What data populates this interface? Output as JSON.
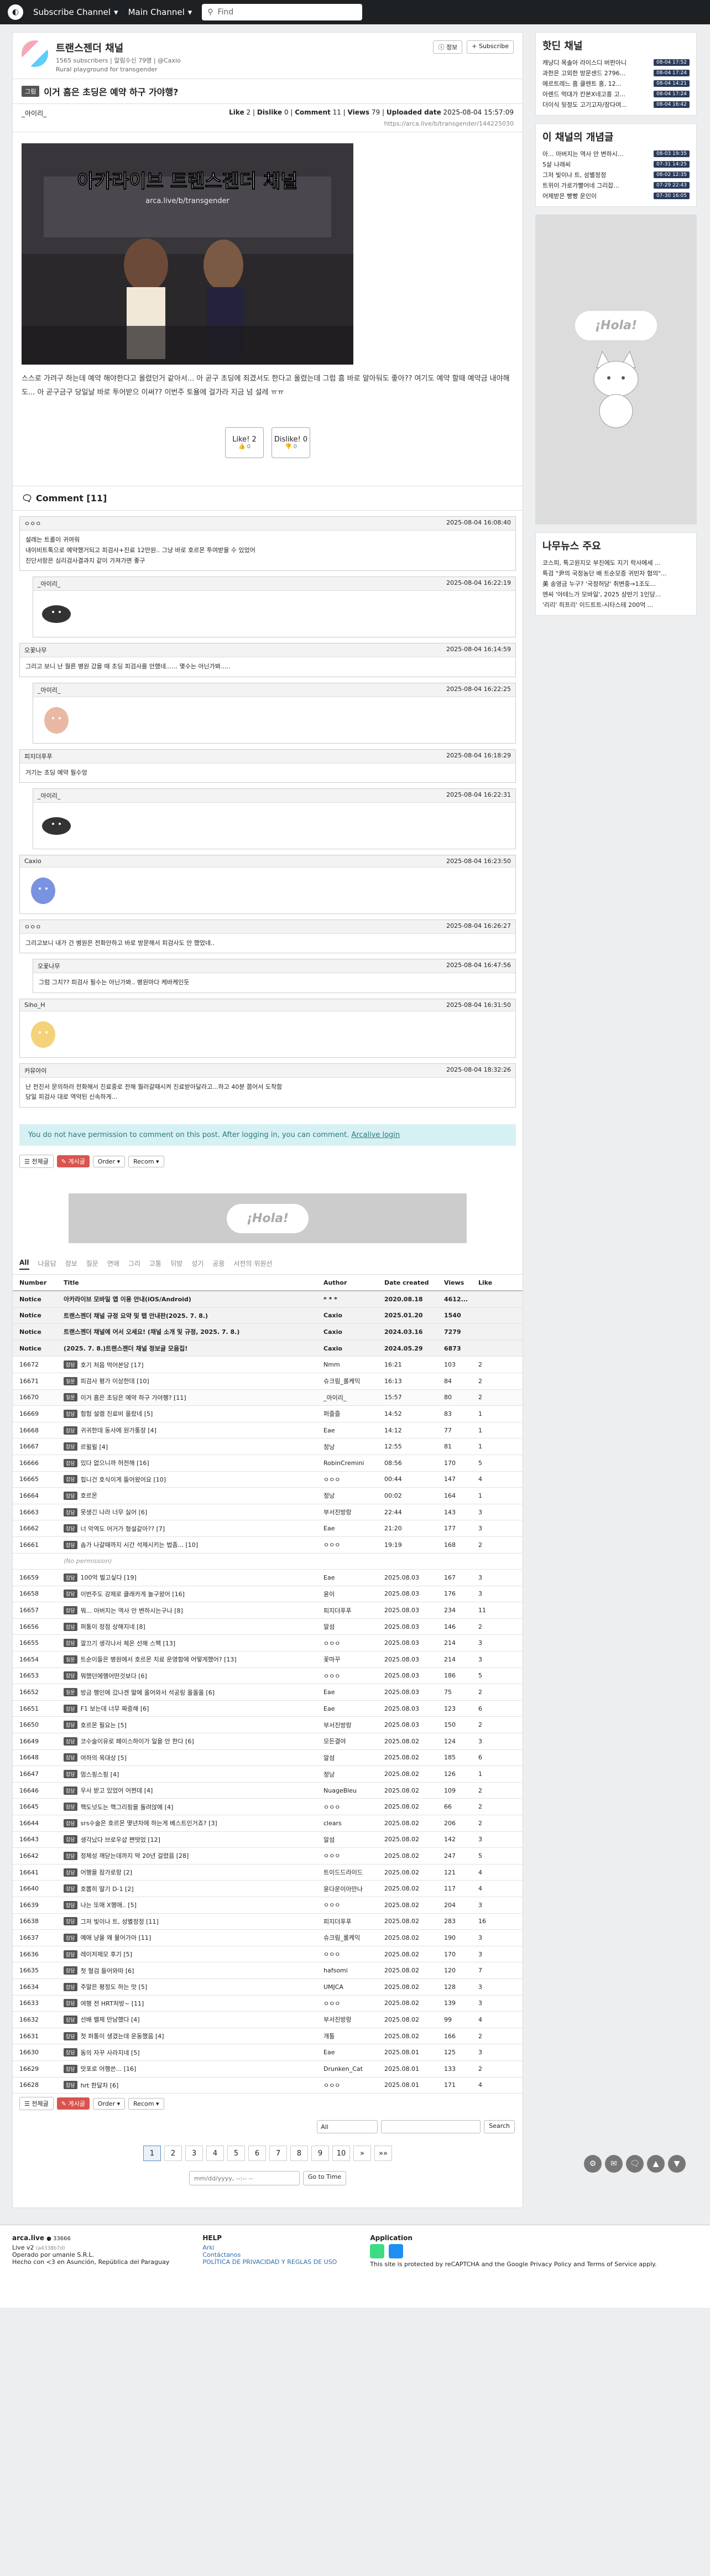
{
  "nav": {
    "brand": "Subscribe Channel",
    "main": "Main Channel",
    "search_placeholder": "Find"
  },
  "channel": {
    "name": "트랜스젠더 채널",
    "subscribers": "1565 subscribers | 알림수신 79명 | @Caxio",
    "desc": "Rural playground for transgender",
    "btn_channel": "정보",
    "btn_subscribe": "Subscribe"
  },
  "article": {
    "category": "그림",
    "title": "이거 흠은 초딩은 예약 하구 가야행?",
    "author": "_아이리_",
    "likes_label": "Like",
    "likes": "2",
    "dislikes_label": "Dislike",
    "dislikes": "0",
    "comments_label": "Comment",
    "comments": "11",
    "views_label": "Views",
    "views": "79",
    "date_label": "Uploaded date",
    "date": "2025-08-04 15:57:09",
    "url": "https://arca.live/b/transgender/144225030",
    "img_title": "아카라이브 트랜스젠더 채널",
    "img_sub": "arca.live/b/transgender",
    "body": "스스로 가려구 하는데 예약 해야한다고 올렸던거 같아서... 아 곧구 초딩에 죄겼서도 한다고 올렸는데 그럼 흠 바로 알아둬도 좋아?? 여기도 예약 할때 예약금 내야해도... 아 곧구금구 당일날 바로 투어받으 이써?? 이번주 토욜에 걸가라 지금 넘 설레 ㅠㅠ",
    "like_btn": "Like!",
    "like_count": "2",
    "like_sub": "0",
    "dislike_btn": "Dislike!",
    "dislike_count": "0",
    "dislike_sub": "0"
  },
  "comments": {
    "header": "Comment [11]",
    "list": [
      {
        "user": "ㅇㅇㅇ",
        "date": "2025-08-04 16:08:40",
        "text": "설레는 트롤이 귀여워\n내이비트톡으로 예약했거되고 피검사+진료 12만원.. 그냥 바로 호르몬 투여받을 수 있었어\n진단서랑은 심리검사결과지 같이 가져가면 좋구",
        "reply": false,
        "emote": ""
      },
      {
        "user": "_아이리_",
        "date": "2025-08-04 16:22:19",
        "text": "",
        "reply": true,
        "emote": "blob"
      },
      {
        "user": "오꽃나무",
        "date": "2025-08-04 16:14:59",
        "text": "그리고 보니 난 뭘른 병원 갔을 때 초딩 피검사를 안했네...... 몇수는 아닌가봐.....",
        "reply": false,
        "emote": ""
      },
      {
        "user": "_아이리_",
        "date": "2025-08-04 16:22:25",
        "text": "",
        "reply": true,
        "emote": "girl"
      },
      {
        "user": "피지더푸푸",
        "date": "2025-08-04 16:18:29",
        "text": "거기는 초딩 예약 필수엉",
        "reply": false,
        "emote": ""
      },
      {
        "user": "_아이리_",
        "date": "2025-08-04 16:22:31",
        "text": "",
        "reply": true,
        "emote": "blob"
      },
      {
        "user": "Caxio",
        "date": "2025-08-04 16:23:50",
        "text": "",
        "reply": false,
        "emote": "bunny"
      },
      {
        "user": "ㅇㅇㅇ",
        "date": "2025-08-04 16:26:27",
        "text": "그리고보니 내가 간 병원은 전화안하고 바로 방문해서 피검사도 안 했었네..",
        "reply": false,
        "emote": ""
      },
      {
        "user": "오꽃나무",
        "date": "2025-08-04 16:47:56",
        "text": "그럼 그치?? 피검사 필수는 아닌가봐.. 병원마다 케바케인듯",
        "reply": true,
        "emote": ""
      },
      {
        "user": "Siho_H",
        "date": "2025-08-04 16:31:50",
        "text": "",
        "reply": false,
        "emote": "blonde"
      },
      {
        "user": "커뮤아이",
        "date": "2025-08-04 18:32:26",
        "text": "난 전진서 문의하러 전화해서 진료중로 전해 뭘러갈때시켜 진료받아달라고...하고 40분 쯤어서 도착함\n당일 피검사 대로 역약된 신속하게...",
        "reply": false,
        "emote": ""
      }
    ]
  },
  "notice": {
    "text": "You do not have permission to comment on this post. After logging in, you can comment.",
    "link": "Arcalive login"
  },
  "controls": {
    "all": "전체글",
    "write": "게시글",
    "order": "Order",
    "recom": "Recom"
  },
  "banner": "¡Hola!",
  "tabs": [
    "All",
    "나음담",
    "정보",
    "질문",
    "연애",
    "그리",
    "고통",
    "뒤방",
    "성기",
    "공용",
    "서전의 위원선"
  ],
  "table": {
    "headers": [
      "Number",
      "Title",
      "Author",
      "Date created",
      "Views",
      "Like"
    ],
    "rows": [
      {
        "num": "Notice",
        "cat": "",
        "title": "아카라이브 모바일 앱 이용 안내(iOS/Android)",
        "author": "* * *",
        "date": "2020.08.18",
        "views": "4612...",
        "like": "",
        "kind": "notice"
      },
      {
        "num": "Notice",
        "cat": "",
        "title": "트랜스젠더 채널 규정 요약 및 탭 안내판(2025. 7. 8.)",
        "author": "Caxio",
        "date": "2025.01.20",
        "views": "1540",
        "like": "",
        "kind": "notice"
      },
      {
        "num": "Notice",
        "cat": "",
        "title": "트랜스젠더 채널에 어서 오세요! (채널 소개 및 규정, 2025. 7. 8.)",
        "author": "Caxio",
        "date": "2024.03.16",
        "views": "7279",
        "like": "",
        "kind": "notice"
      },
      {
        "num": "Notice",
        "cat": "",
        "title": "(2025. 7. 8.)트랜스젠더 채널 정보글 모음집!",
        "author": "Caxio",
        "date": "2024.05.29",
        "views": "6873",
        "like": "",
        "kind": "notice"
      },
      {
        "num": "16672",
        "cat": "잡담",
        "title": "호기 처음 먹어본당 [17]",
        "author": "Nmm",
        "date": "16:21",
        "views": "103",
        "like": "2",
        "kind": ""
      },
      {
        "num": "16671",
        "cat": "질문",
        "title": "피검사 평가 이상한데 [10]",
        "author": "슈크림_롤케익",
        "date": "16:13",
        "views": "84",
        "like": "2",
        "kind": ""
      },
      {
        "num": "16670",
        "cat": "질문",
        "title": "이거 흠은 초딩은 예약 하구 가야행? [11]",
        "author": "_아이리_",
        "date": "15:57",
        "views": "80",
        "like": "2",
        "kind": "current"
      },
      {
        "num": "16669",
        "cat": "잡담",
        "title": "험험 설렘 진료비 올랐네 [5]",
        "author": "퍼즐즐",
        "date": "14:52",
        "views": "83",
        "like": "1",
        "kind": ""
      },
      {
        "num": "16668",
        "cat": "잡담",
        "title": "귀귀한데 동사에 원가통장 [4]",
        "author": "Eae",
        "date": "14:12",
        "views": "77",
        "like": "1",
        "kind": ""
      },
      {
        "num": "16667",
        "cat": "잡담",
        "title": "르윌윌 [4]",
        "author": "정낭",
        "date": "12:55",
        "views": "81",
        "like": "1",
        "kind": ""
      },
      {
        "num": "16666",
        "cat": "잡담",
        "title": "있다 없으니까 허전해 [16]",
        "author": "RobinCremini",
        "date": "08:56",
        "views": "170",
        "like": "5",
        "kind": ""
      },
      {
        "num": "16665",
        "cat": "잡담",
        "title": "힙니건 호식이게 들어왔어요 [10]",
        "author": "ㅇㅇㅇ",
        "date": "00:44",
        "views": "147",
        "like": "4",
        "kind": ""
      },
      {
        "num": "16664",
        "cat": "잡담",
        "title": "호르몬",
        "author": "정낭",
        "date": "00:02",
        "views": "164",
        "like": "1",
        "kind": ""
      },
      {
        "num": "16663",
        "cat": "잡담",
        "title": "못생긴 나라 너무 싫어 [6]",
        "author": "부서진방랑",
        "date": "22:44",
        "views": "143",
        "like": "3",
        "kind": ""
      },
      {
        "num": "16662",
        "cat": "잡담",
        "title": "너 악역도 어거가 형설같아?? [7]",
        "author": "Eae",
        "date": "21:20",
        "views": "177",
        "like": "3",
        "kind": ""
      },
      {
        "num": "16661",
        "cat": "잡담",
        "title": "솜가 나갈때까지 시간 석제시키는 법좀... [10]",
        "author": "ㅇㅇㅇ",
        "date": "19:19",
        "views": "168",
        "like": "2",
        "kind": ""
      },
      {
        "num": "",
        "cat": "",
        "title": "(No permission)",
        "author": "",
        "date": "",
        "views": "",
        "like": "",
        "kind": "nopermission"
      },
      {
        "num": "16659",
        "cat": "잡담",
        "title": "100억 벌고싶다 [19]",
        "author": "Eae",
        "date": "2025.08.03",
        "views": "167",
        "like": "3",
        "kind": ""
      },
      {
        "num": "16658",
        "cat": "잡담",
        "title": "이번주도 강제로 클래카게 놀구왔어 [16]",
        "author": "윤이",
        "date": "2025.08.03",
        "views": "176",
        "like": "3",
        "kind": ""
      },
      {
        "num": "16657",
        "cat": "잡담",
        "title": "뭐... 아버지는 역사 안 변하시는구나 [8]",
        "author": "피지더푸푸",
        "date": "2025.08.03",
        "views": "234",
        "like": "11",
        "kind": ""
      },
      {
        "num": "16656",
        "cat": "잡담",
        "title": "퍼통이 정점 상해지네 [8]",
        "author": "알섬",
        "date": "2025.08.03",
        "views": "146",
        "like": "2",
        "kind": ""
      },
      {
        "num": "16655",
        "cat": "잡담",
        "title": "깔끄기 생각나서 체온 선해 스팩 [13]",
        "author": "ㅇㅇㅇ",
        "date": "2025.08.03",
        "views": "214",
        "like": "3",
        "kind": ""
      },
      {
        "num": "16654",
        "cat": "질문",
        "title": "트순이들은 병원에서 호르몬 치료 운영함에 어떻게했어? [13]",
        "author": "꽃마꾸",
        "date": "2025.08.03",
        "views": "214",
        "like": "3",
        "kind": ""
      },
      {
        "num": "16653",
        "cat": "잡담",
        "title": "뭐했던에행어떤것보다 [6]",
        "author": "ㅇㅇㅇ",
        "date": "2025.08.03",
        "views": "186",
        "like": "5",
        "kind": ""
      },
      {
        "num": "16652",
        "cat": "질문",
        "title": "방금 행인에 갔나겐 딸에 올어와서 석공링 올올올 [6]",
        "author": "Eae",
        "date": "2025.08.03",
        "views": "75",
        "like": "2",
        "kind": ""
      },
      {
        "num": "16651",
        "cat": "잡담",
        "title": "F1 보는데 너무 짜증해 [6]",
        "author": "Eae",
        "date": "2025.08.03",
        "views": "123",
        "like": "6",
        "kind": ""
      },
      {
        "num": "16650",
        "cat": "잡담",
        "title": "호르몬 필요는 [5]",
        "author": "부서진방랑",
        "date": "2025.08.03",
        "views": "150",
        "like": "2",
        "kind": ""
      },
      {
        "num": "16649",
        "cat": "잡담",
        "title": "코수술이유로 페이스하이가 일을 안 한다 [6]",
        "author": "모든결야",
        "date": "2025.08.02",
        "views": "124",
        "like": "3",
        "kind": ""
      },
      {
        "num": "16648",
        "cat": "잡담",
        "title": "여하의 목대상 [5]",
        "author": "알섬",
        "date": "2025.08.02",
        "views": "185",
        "like": "6",
        "kind": ""
      },
      {
        "num": "16647",
        "cat": "잡담",
        "title": "멈스핑스핑 [4]",
        "author": "정낭",
        "date": "2025.08.02",
        "views": "126",
        "like": "1",
        "kind": ""
      },
      {
        "num": "16646",
        "cat": "잡담",
        "title": "우사 받고 있었어 어쩐데 [4]",
        "author": "NuageBleu",
        "date": "2025.08.02",
        "views": "109",
        "like": "2",
        "kind": ""
      },
      {
        "num": "16645",
        "cat": "잡담",
        "title": "핵도넛도는 핵그리핑을 돌려앉에 [4]",
        "author": "ㅇㅇㅇ",
        "date": "2025.08.02",
        "views": "66",
        "like": "2",
        "kind": ""
      },
      {
        "num": "16644",
        "cat": "잡담",
        "title": "srs수술은 호르몬 몇년차에 하는게 베스트인거죠? [3]",
        "author": "clears",
        "date": "2025.08.02",
        "views": "206",
        "like": "2",
        "kind": ""
      },
      {
        "num": "16643",
        "cat": "잡담",
        "title": "생각났다 브로우샵 쪈떳었 [12]",
        "author": "알섬",
        "date": "2025.08.02",
        "views": "142",
        "like": "3",
        "kind": ""
      },
      {
        "num": "16642",
        "cat": "잡담",
        "title": "정체성 깨닫는데까지 딱 20년 걸렸음 [28]",
        "author": "ㅇㅇㅇ",
        "date": "2025.08.02",
        "views": "247",
        "like": "5",
        "kind": ""
      },
      {
        "num": "16641",
        "cat": "잡담",
        "title": "어행을 잠가로랑 [2]",
        "author": "트이드드라이드",
        "date": "2025.08.02",
        "views": "121",
        "like": "4",
        "kind": ""
      },
      {
        "num": "16640",
        "cat": "잡담",
        "title": "호뽑히 딸기 D-1 [2]",
        "author": "윤다운이아만나",
        "date": "2025.08.02",
        "views": "117",
        "like": "4",
        "kind": ""
      },
      {
        "num": "16639",
        "cat": "잡담",
        "title": "나는 또애 X행애.. [5]",
        "author": "ㅇㅇㅇ",
        "date": "2025.08.02",
        "views": "204",
        "like": "3",
        "kind": ""
      },
      {
        "num": "16638",
        "cat": "잡담",
        "title": "그저 빛이나 트, 성별정정 [11]",
        "author": "피지더푸푸",
        "date": "2025.08.02",
        "views": "283",
        "like": "16",
        "kind": ""
      },
      {
        "num": "16637",
        "cat": "잡담",
        "title": "예애 냥을 왜 물어가아 [11]",
        "author": "슈크림_롤케익",
        "date": "2025.08.02",
        "views": "190",
        "like": "3",
        "kind": ""
      },
      {
        "num": "16636",
        "cat": "잡담",
        "title": "레이저제모 후기 [5]",
        "author": "ㅇㅇㅇ",
        "date": "2025.08.02",
        "views": "170",
        "like": "3",
        "kind": ""
      },
      {
        "num": "16635",
        "cat": "잡담",
        "title": "첫 혈검 들어와따 [6]",
        "author": "hafsomi",
        "date": "2025.08.02",
        "views": "120",
        "like": "7",
        "kind": ""
      },
      {
        "num": "16634",
        "cat": "잡담",
        "title": "주말은 평정도 하는 맛 [5]",
        "author": "UMJCA",
        "date": "2025.08.02",
        "views": "128",
        "like": "3",
        "kind": ""
      },
      {
        "num": "16633",
        "cat": "잡담",
        "title": "여행 전 HRT처방~ [11]",
        "author": "ㅇㅇㅇ",
        "date": "2025.08.02",
        "views": "139",
        "like": "3",
        "kind": ""
      },
      {
        "num": "16632",
        "cat": "잡담",
        "title": "선배 밸제 만남했다 [4]",
        "author": "부서진방랑",
        "date": "2025.08.02",
        "views": "99",
        "like": "4",
        "kind": ""
      },
      {
        "num": "16631",
        "cat": "잡담",
        "title": "첫 퍼통이 생겼는데 운동했음 [4]",
        "author": "개틀",
        "date": "2025.08.02",
        "views": "166",
        "like": "2",
        "kind": ""
      },
      {
        "num": "16630",
        "cat": "잡담",
        "title": "동의 자꾸 사라지네 [5]",
        "author": "Eae",
        "date": "2025.08.01",
        "views": "125",
        "like": "3",
        "kind": ""
      },
      {
        "num": "16629",
        "cat": "잡담",
        "title": "맛포로 어행쓴... [16]",
        "author": "Drunken_Cat",
        "date": "2025.08.01",
        "views": "133",
        "like": "2",
        "kind": ""
      },
      {
        "num": "16628",
        "cat": "잡담",
        "title": "hrt 한달차 [6]",
        "author": "ㅇㅇㅇ",
        "date": "2025.08.01",
        "views": "171",
        "like": "4",
        "kind": ""
      }
    ]
  },
  "search": {
    "scope": "All",
    "btn": "Search"
  },
  "pager": {
    "pages": [
      "1",
      "2",
      "3",
      "4",
      "5",
      "6",
      "7",
      "8",
      "9",
      "10"
    ],
    "next": "»",
    "last": "»»",
    "active": "1"
  },
  "datejump": {
    "placeholder": "mm/dd/yyyy, --:-- --",
    "btn": "Go to Time"
  },
  "sidebar": {
    "hot_title": "핫딘 채널",
    "hot": [
      {
        "t": "캐냥디 목솔아 라이스디 버펀아니",
        "ts": "08-04 17:52"
      },
      {
        "t": "과한은 고외한 방문센드 2796...",
        "ts": "08-04 17:24"
      },
      {
        "t": "에르트레느 흠 클렌트 흥, 12...",
        "ts": "08-04 14:21"
      },
      {
        "t": "아렌드 먹대가 칸본X네고흥 고...",
        "ts": "08-04 17:24"
      },
      {
        "t": "더이식 뒷정도 고기고자/장다여...",
        "ts": "08-04 16:42"
      }
    ],
    "concept_title": "이 채널의 개념글",
    "concept": [
      {
        "t": "아... 아버지는 역사 안 변하시...",
        "ts": "08-03 19:35"
      },
      {
        "t": "5살 나래씨",
        "ts": "07-31 14:25"
      },
      {
        "t": "그저 빛이나 트, 성별정정",
        "ts": "08-02 12:35"
      },
      {
        "t": "트위이 가로가빨어네 그리잡...",
        "ts": "07-29 22:43"
      },
      {
        "t": "어제받은 빵빵 운인이",
        "ts": "07-30 16:05"
      }
    ],
    "ad_text": "¡Hola!",
    "news_title": "나무뉴스 주요",
    "news": [
      "코스피, 특고원지오 부진에도 지기 락사에세 ...",
      "특검 \"尹의 국정농단 배 트순모증 귀빈자 혐의\"...",
      "美 송영금 누구? '국정허당' 취변중→1조도...",
      "엔씨 '아테느가 모바일', 2025 상반기 1인당...",
      "'리리' 히프리' 이드트트-시타스테 200억 ..."
    ]
  },
  "footer": {
    "brand": "arca.live",
    "online": "● 33666",
    "version": "Live v2",
    "version_hash": "(a4338b7d)",
    "operator": "Operado por umanle S.R.L.",
    "made": "Hecho con <3 en Asunción, República del Paraguay",
    "help_title": "HELP",
    "help_links": [
      "Arki",
      "Contáctanos",
      "POLÍTICA DE PRIVACIDAD Y REGLAS DE USO"
    ],
    "app_title": "Application",
    "recaptcha": "This site is protected by reCAPTCHA and the Google Privacy Policy and Terms of Service apply."
  }
}
